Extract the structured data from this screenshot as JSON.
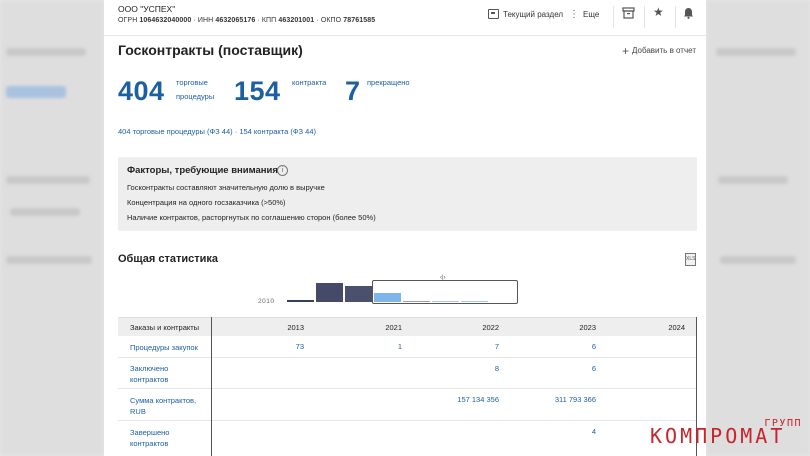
{
  "header": {
    "company": "ООО \"УСПЕХ\"",
    "ogrn_label": "ОГРН",
    "ogrn": "1064632040000",
    "inn_label": "ИНН",
    "inn": "4632065176",
    "kpp_label": "КПП",
    "kpp": "463201001",
    "okpo_label": "ОКПО",
    "okpo": "78761585",
    "current_section": "Текущий раздел",
    "more": "Еще"
  },
  "page": {
    "title": "Госконтракты (поставщик)",
    "add_to_report": "Добавить в отчет"
  },
  "summary": [
    {
      "value": "404",
      "caption1": "торговые",
      "caption2": "процедуры"
    },
    {
      "value": "154",
      "caption1": "контракта",
      "caption2": ""
    },
    {
      "value": "7",
      "caption1": "прекращено",
      "caption2": ""
    }
  ],
  "links": {
    "procedures": "404 торговые процедуры (ФЗ 44)",
    "separator": "·",
    "contracts": "154 контракта (ФЗ 44)"
  },
  "factors": {
    "title": "Факторы, требующие внимания",
    "items": [
      "Госконтракты составляют значительную долю в выручке",
      "Концентрация на одного госзаказчика (>50%)",
      "Наличие контрактов, расторгнутых по соглашению сторон (более 50%)"
    ]
  },
  "stats": {
    "title": "Общая статистика",
    "mini_start_year": "2010",
    "mini_bars": [
      {
        "level": 0.1,
        "color": "#3b3f5c"
      },
      {
        "level": 0.95,
        "color": "#454a68"
      },
      {
        "level": 0.8,
        "color": "#4b506d"
      },
      {
        "level": 0.45,
        "color": "#7fb5e8"
      },
      {
        "level": 0.05,
        "color": "#9a9fb3"
      },
      {
        "level": 0.05,
        "color": "#a9c9ea"
      },
      {
        "level": 0.05,
        "color": "#a9c9ea"
      }
    ],
    "table": {
      "first_col": "Заказы и контракты",
      "years": [
        "2013",
        "2021",
        "2022",
        "2023",
        "2024"
      ],
      "rows": [
        {
          "label1": "Процедуры закупок",
          "label2": "",
          "values": [
            "73",
            "1",
            "7",
            "6",
            ""
          ]
        },
        {
          "label1": "Заключено",
          "label2": "контрактов",
          "values": [
            "",
            "",
            "8",
            "6",
            ""
          ]
        },
        {
          "label1": "Сумма контрактов,",
          "label2": "RUB",
          "values": [
            "",
            "",
            "157 134 356",
            "311 793 366",
            ""
          ]
        },
        {
          "label1": "Завершено",
          "label2": "контрактов",
          "values": [
            "",
            "",
            "",
            "4",
            ""
          ]
        }
      ]
    }
  },
  "watermark": {
    "small": "ГРУПП",
    "big": "КОМПРОМАТ"
  }
}
